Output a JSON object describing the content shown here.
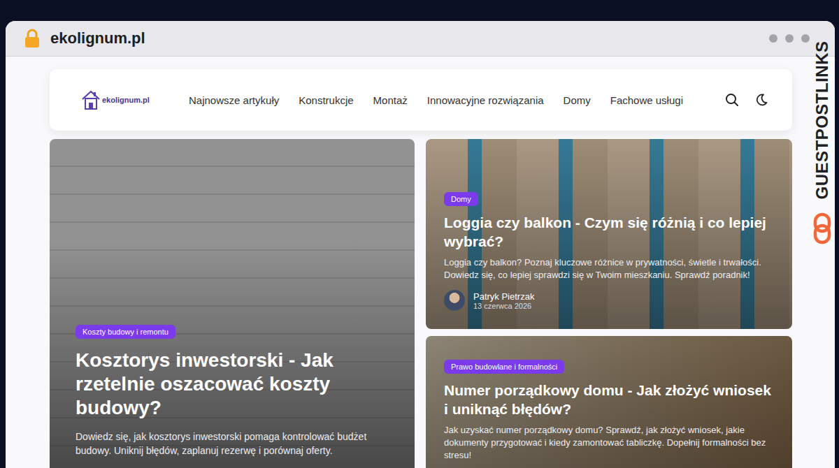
{
  "browser": {
    "url": "ekolignum.pl"
  },
  "brand": {
    "text": "GUESTPOSTLINKS"
  },
  "header": {
    "logo": "ekolignum.pl",
    "nav": [
      {
        "label": "Najnowsze artykuły"
      },
      {
        "label": "Konstrukcje"
      },
      {
        "label": "Montaż"
      },
      {
        "label": "Innowacyjne rozwiązania"
      },
      {
        "label": "Domy"
      },
      {
        "label": "Fachowe usługi"
      }
    ]
  },
  "featured": {
    "category": "Koszty budowy i remontu",
    "title": "Kosztorys inwestorski - Jak rzetelnie oszacować koszty budowy?",
    "excerpt": "Dowiedz się, jak kosztorys inwestorski pomaga kontrolować budżet budowy. Uniknij błędów, zaplanuj rezerwę i porównaj oferty."
  },
  "side_posts": [
    {
      "category": "Domy",
      "title": "Loggia czy balkon - Czym się różnią i co lepiej wybrać?",
      "excerpt": "Loggia czy balkon? Poznaj kluczowe różnice w prywatności, świetle i trwałości. Dowiedz się, co lepiej sprawdzi się w Twoim mieszkaniu. Sprawdź poradnik!",
      "author": "Patryk Pietrzak",
      "date": "13 czerwca 2026"
    },
    {
      "category": "Prawo budowlane i formalności",
      "title": "Numer porządkowy domu - Jak złożyć wniosek i uniknąć błędów?",
      "excerpt": "Jak uzyskać numer porządkowy domu? Sprawdź, jak złożyć wniosek, jakie dokumenty przygotować i kiedy zamontować tabliczkę. Dopełnij formalności bez stresu!"
    }
  ]
}
